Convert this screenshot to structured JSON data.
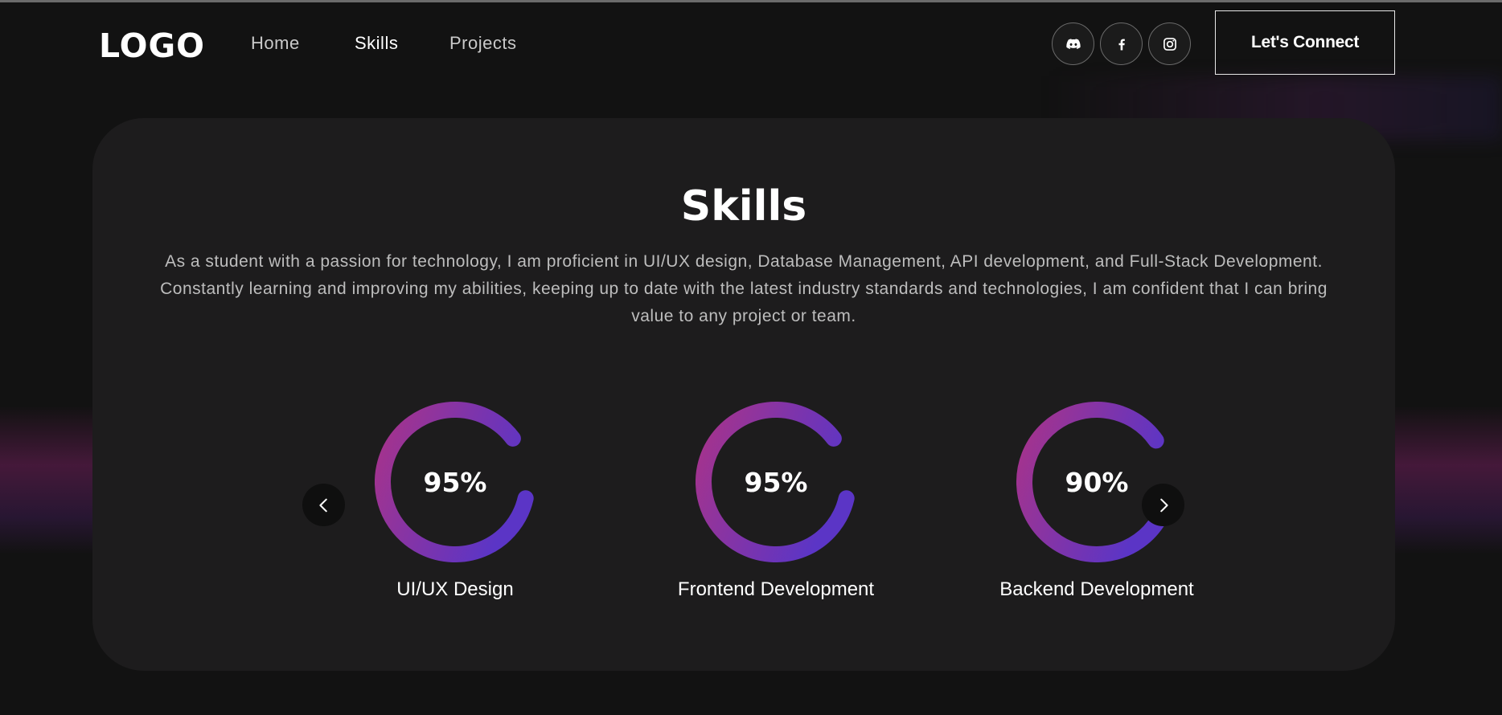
{
  "nav": {
    "logo": "LOGO",
    "links": [
      {
        "label": "Home",
        "active": false
      },
      {
        "label": "Skills",
        "active": true
      },
      {
        "label": "Projects",
        "active": false
      }
    ],
    "socials": [
      "discord-icon",
      "facebook-icon",
      "instagram-icon"
    ],
    "cta_label": "Let's Connect"
  },
  "skills": {
    "title": "Skills",
    "description": "As a student with a passion for technology, I am proficient in UI/UX design, Database Management, API development, and Full-Stack Development. Constantly learning and improving my abilities, keeping up to date with the latest industry standards and technologies, I am confident that I can bring value to any project or team.",
    "items": [
      {
        "label": "UI/UX Design",
        "percent_text": "95%",
        "percent": 95
      },
      {
        "label": "Frontend Development",
        "percent_text": "95%",
        "percent": 95
      },
      {
        "label": "Backend Development",
        "percent_text": "90%",
        "percent": 90
      }
    ]
  },
  "colors": {
    "background": "#121212",
    "card": "#1d1c1d",
    "ring_start": "#a8338a",
    "ring_end": "#5b35c6"
  }
}
